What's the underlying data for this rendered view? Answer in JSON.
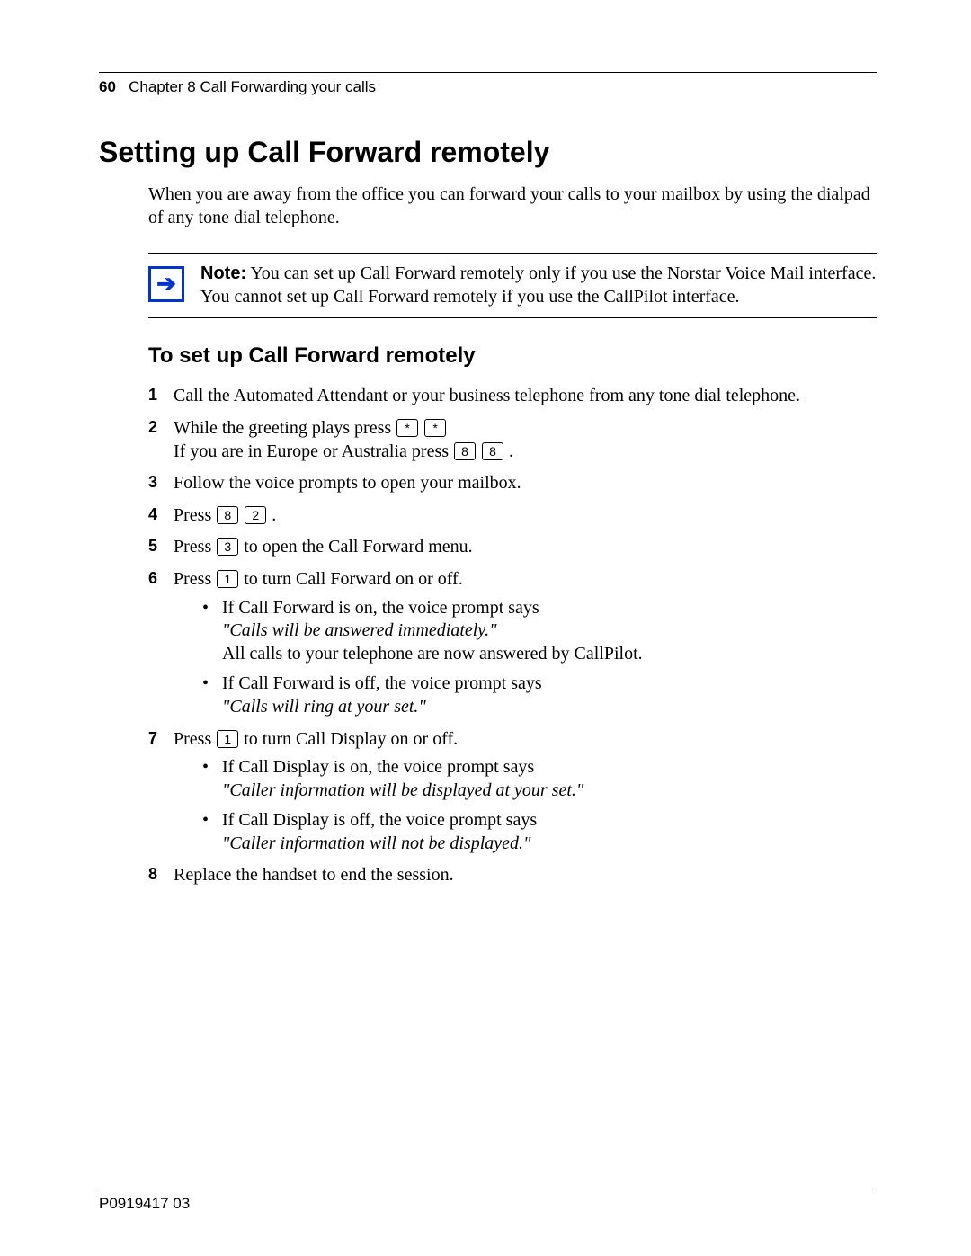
{
  "header": {
    "page_number": "60",
    "chapter_text": "Chapter 8  Call Forwarding your calls"
  },
  "h1": "Setting up Call Forward remotely",
  "intro": "When you are away from the office you can forward your calls to your mailbox by using the dialpad of any tone dial telephone.",
  "note": {
    "label": "Note:",
    "text": " You can set up Call Forward remotely only if you use the Norstar Voice Mail interface. You cannot set up Call Forward remotely if you use the CallPilot interface."
  },
  "h2": "To set up Call Forward remotely",
  "steps": {
    "s1": "Call the Automated Attendant or your business telephone from any tone dial telephone.",
    "s2a": "While the greeting plays press ",
    "s2b": "If you are in Europe or Australia press ",
    "s3": "Follow the voice prompts to open your mailbox.",
    "s4": "Press ",
    "s5a": "Press ",
    "s5b": " to open the Call Forward menu.",
    "s6a": "Press ",
    "s6b": " to turn Call Forward on or off.",
    "s6_b1a": "If Call Forward is on, the voice prompt says",
    "s6_b1q": "\"Calls will be answered immediately.\"",
    "s6_b1c": "All calls to your telephone are now answered by CallPilot.",
    "s6_b2a": "If Call Forward is off, the voice prompt says",
    "s6_b2q": "\"Calls will ring at your set.\"",
    "s7a": "Press ",
    "s7b": " to turn Call Display on or off.",
    "s7_b1a": "If Call Display is on, the voice prompt says",
    "s7_b1q": "\"Caller information will be displayed at your set.\"",
    "s7_b2a": "If Call Display is off, the voice prompt says",
    "s7_b2q": "\"Caller information will not be displayed.\"",
    "s8": "Replace the handset to end the session."
  },
  "keys": {
    "star": "*",
    "eight": "8",
    "two": "2",
    "three": "3",
    "one": "1"
  },
  "footer": "P0919417 03"
}
